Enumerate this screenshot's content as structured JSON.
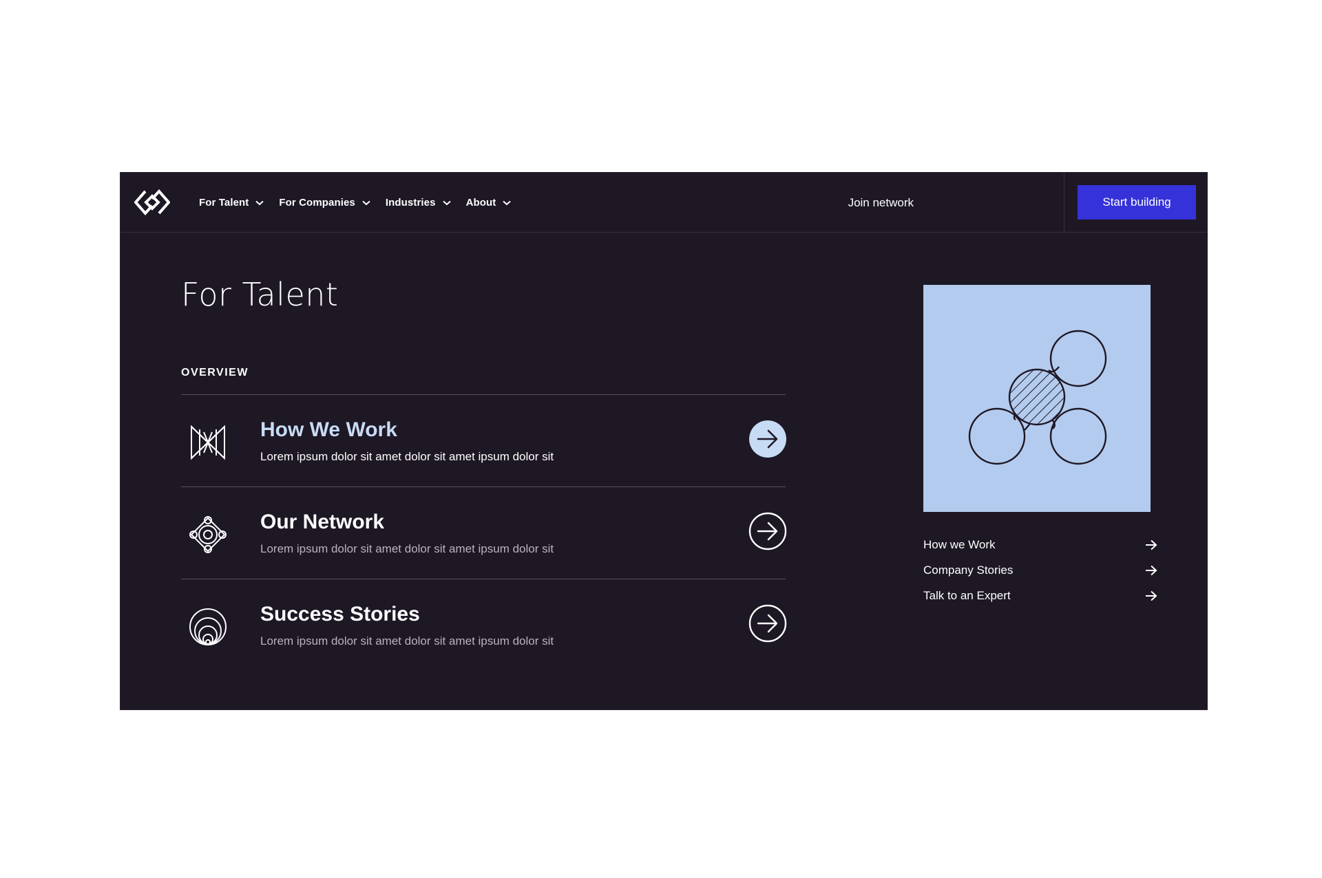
{
  "nav": {
    "menu": [
      {
        "label": "For Talent",
        "icon": "chevron-down-icon"
      },
      {
        "label": "For Companies",
        "icon": "chevron-down-icon"
      },
      {
        "label": "Industries",
        "icon": "chevron-down-icon"
      },
      {
        "label": "About",
        "icon": "chevron-down-icon"
      }
    ],
    "join_label": "Join network",
    "cta_label": "Start building"
  },
  "page": {
    "title": "For Talent",
    "section_label": "OVERVIEW"
  },
  "items": [
    {
      "title": "How We Work",
      "description": "Lorem ipsum dolor sit amet dolor sit amet ipsum dolor sit",
      "icon": "weave-icon",
      "active": true
    },
    {
      "title": "Our Network",
      "description": "Lorem ipsum dolor sit amet dolor sit amet ipsum dolor sit",
      "icon": "network-nodes-icon",
      "active": false
    },
    {
      "title": "Success Stories",
      "description": "Lorem ipsum dolor sit amet dolor sit amet ipsum dolor sit",
      "icon": "concentric-circles-icon",
      "active": false
    }
  ],
  "side_links": [
    {
      "label": "How we Work"
    },
    {
      "label": "Company Stories"
    },
    {
      "label": "Talk to an Expert"
    }
  ],
  "colors": {
    "background": "#1e1724",
    "accent": "#3532d9",
    "highlight": "#c7dbf5",
    "card": "#b3cbee"
  }
}
